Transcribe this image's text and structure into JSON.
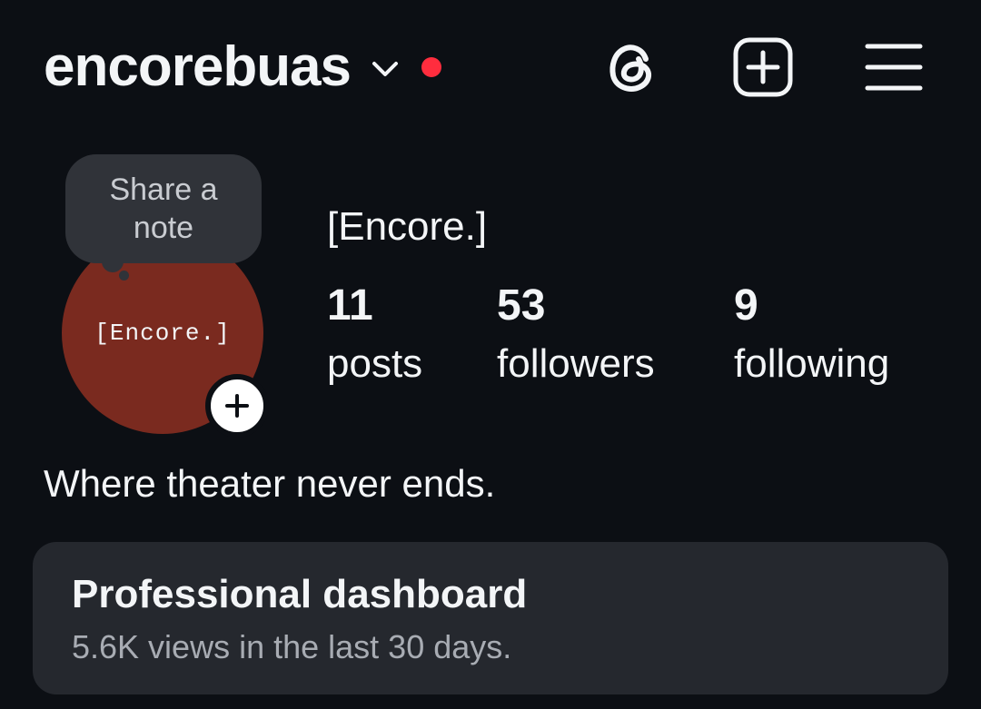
{
  "header": {
    "username": "encorebuas",
    "dropdown_icon": "chevron-down-icon",
    "notification_dot_color": "#ff2d3e",
    "icons": [
      "threads-icon",
      "create-icon",
      "menu-icon"
    ]
  },
  "profile": {
    "note_prompt": "Share a note",
    "avatar_text": "[Encore.]",
    "avatar_color": "#7a2a1f",
    "display_name": "[Encore.]",
    "stats": {
      "posts": {
        "count": "11",
        "label": "posts"
      },
      "followers": {
        "count": "53",
        "label": "followers"
      },
      "following": {
        "count": "9",
        "label": "following"
      }
    },
    "bio": "Where theater never ends."
  },
  "dashboard": {
    "title": "Professional dashboard",
    "subtitle": "5.6K views in the last 30 days."
  }
}
